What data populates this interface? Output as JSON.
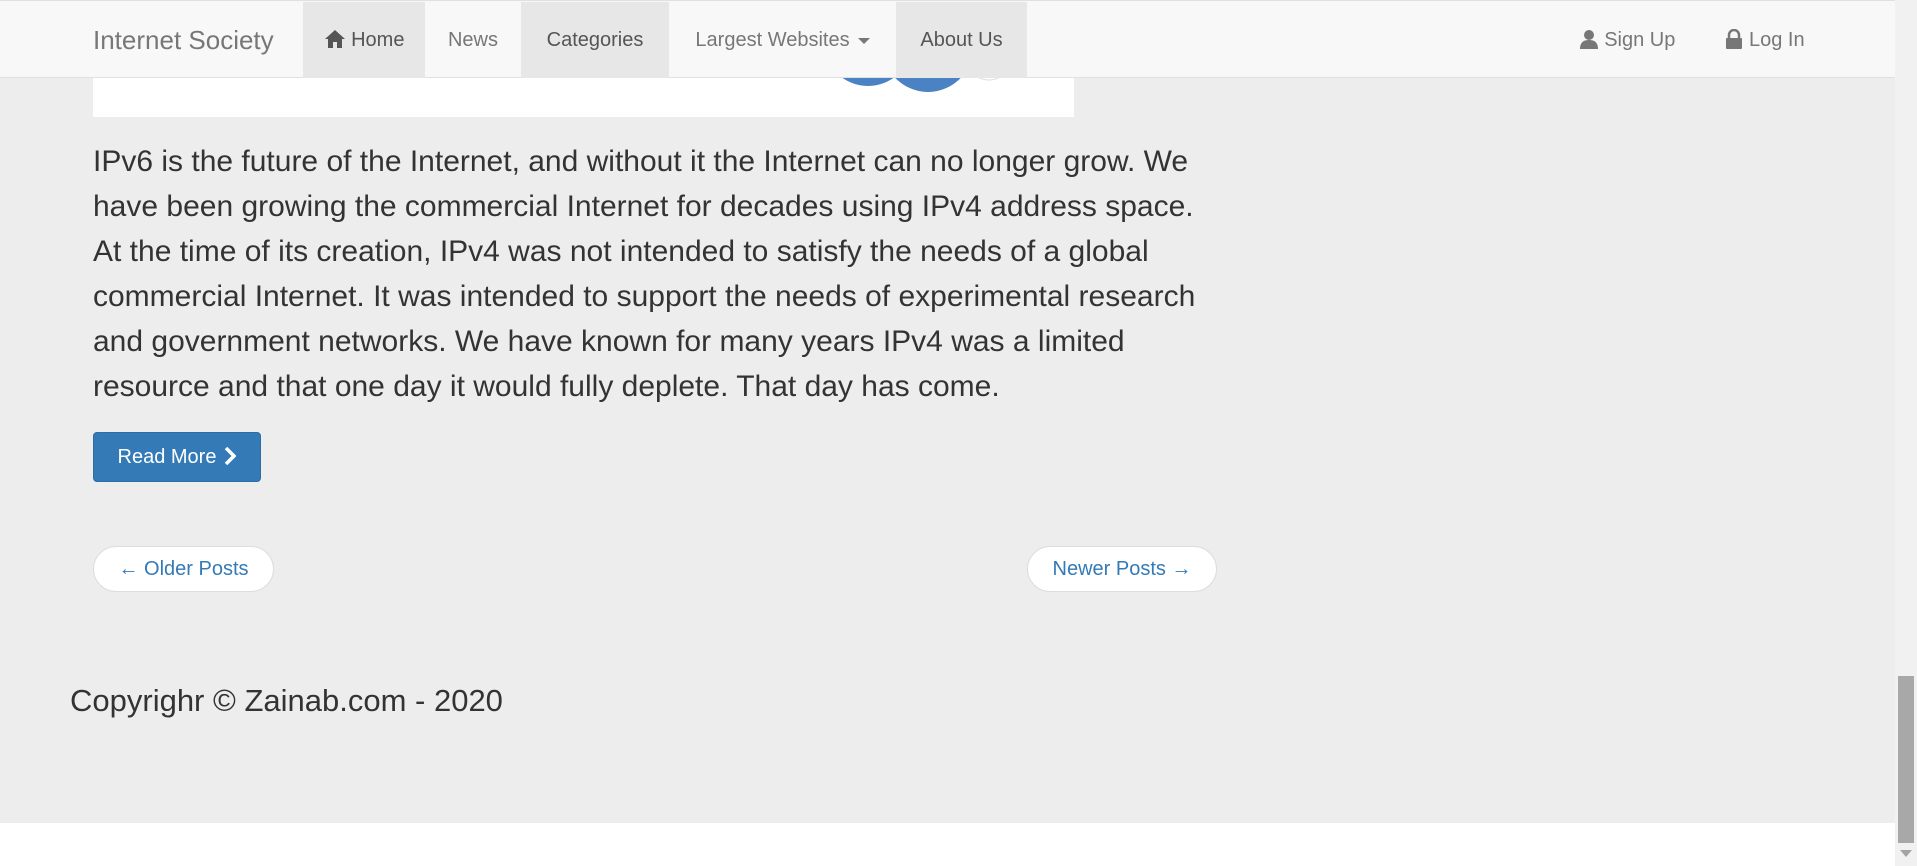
{
  "navbar": {
    "brand": "Internet Society",
    "items": [
      {
        "label": "Home",
        "icon": "home-icon"
      },
      {
        "label": "News"
      },
      {
        "label": "Categories"
      },
      {
        "label": "Largest Websites",
        "icon": "caret-down-icon"
      },
      {
        "label": "About Us"
      }
    ],
    "right": [
      {
        "label": "Sign Up",
        "icon": "user-icon"
      },
      {
        "label": "Log In",
        "icon": "lock-icon"
      }
    ]
  },
  "post": {
    "text": "IPv6 is the future of the Internet, and without it the Internet can no longer grow. We have been growing the commercial Internet for decades using IPv4 address space. At the time of its creation, IPv4 was not intended to satisfy the needs of a global commercial Internet. It was intended to support the needs of experimental research and government networks. We have known for many years IPv4 was a limited resource and that one day it would fully deplete. That day has come.",
    "read_more": "Read More"
  },
  "pager": {
    "older": "← Older Posts",
    "newer": "Newer Posts →"
  },
  "footer": {
    "copyright": "Copyrighr © Zainab.com - 2020"
  },
  "colors": {
    "primary": "#337ab7",
    "page_bg": "#ededed",
    "navbar_bg": "#f8f8f8"
  }
}
